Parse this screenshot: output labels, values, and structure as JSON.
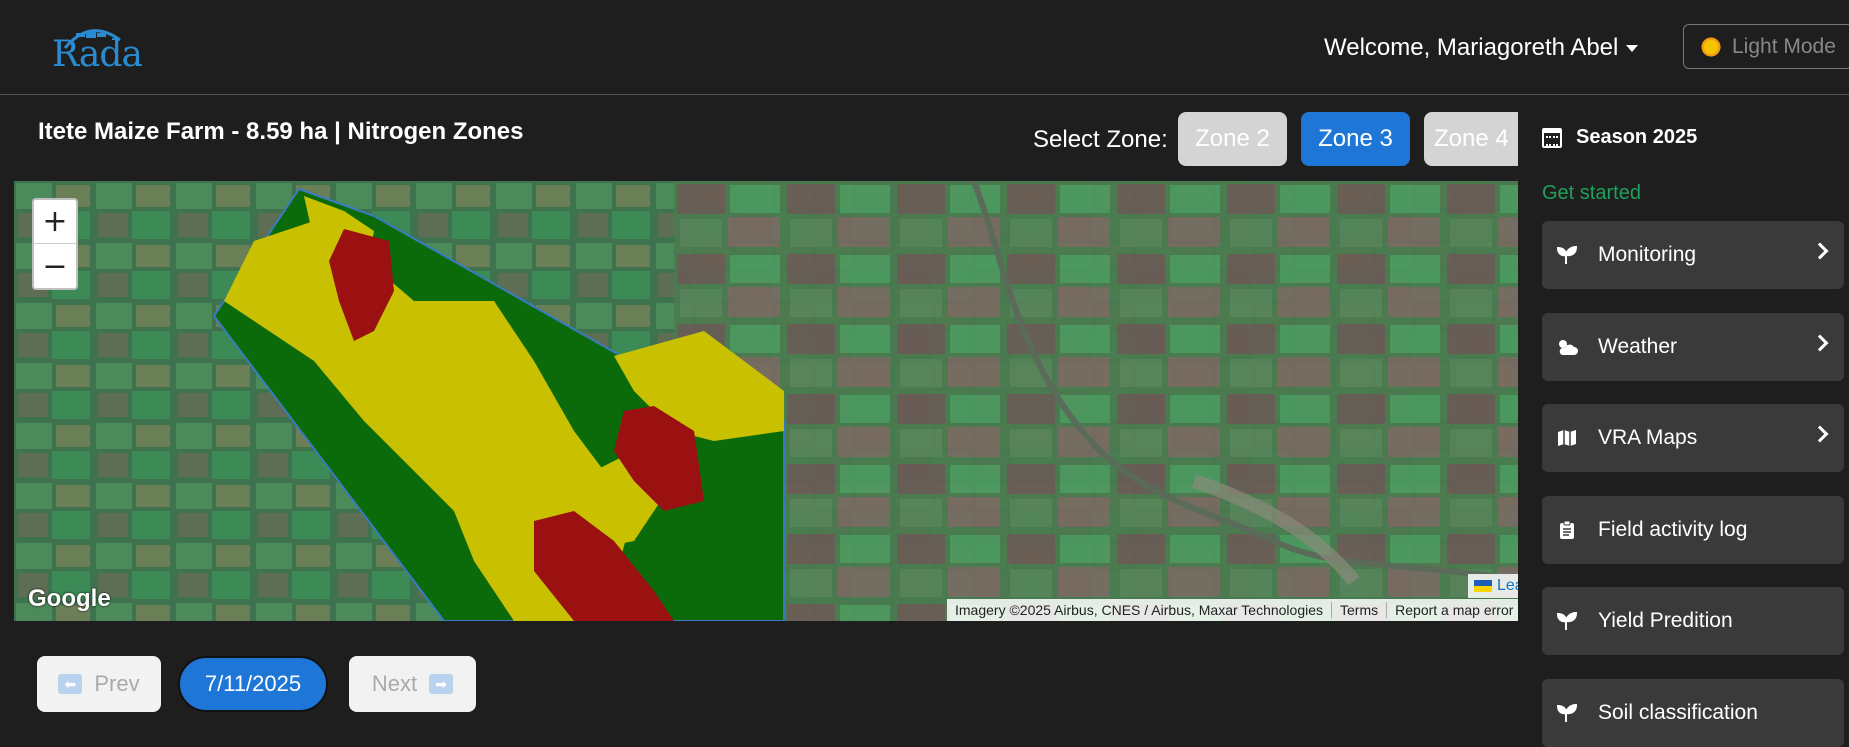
{
  "header": {
    "logo_text": "Rada",
    "welcome": "Welcome, Mariagoreth Abel",
    "mode_label": "Light Mode"
  },
  "main": {
    "title": "Itete Maize Farm - 8.59 ha | Nitrogen Zones",
    "select_zone_label": "Select Zone:",
    "zones": [
      {
        "label": "Zone 2",
        "active": false
      },
      {
        "label": "Zone 3",
        "active": true
      },
      {
        "label": "Zone 4",
        "active": false
      }
    ]
  },
  "map": {
    "zoom_in": "+",
    "zoom_out": "−",
    "google": "Google",
    "leaflet": "Leaflet",
    "attribution": {
      "imagery": "Imagery ©2025 Airbus, CNES / Airbus, Maxar Technologies",
      "terms": "Terms",
      "report": "Report a map error"
    },
    "zone_colors": {
      "high": "#9b1010",
      "medium": "#c8c000",
      "low": "#0b6b0b"
    }
  },
  "date_nav": {
    "prev": "Prev",
    "date": "7/11/2025",
    "next": "Next"
  },
  "sidebar": {
    "season": "Season 2025",
    "get_started": "Get started",
    "items": [
      {
        "label": "Monitoring",
        "icon": "seedling-icon",
        "chevron": true
      },
      {
        "label": "Weather",
        "icon": "cloud-sun-icon",
        "chevron": true
      },
      {
        "label": "VRA Maps",
        "icon": "map-icon",
        "chevron": true
      },
      {
        "label": "Field activity log",
        "icon": "clipboard-icon",
        "chevron": false
      },
      {
        "label": "Yield Predition",
        "icon": "seedling-icon",
        "chevron": false
      },
      {
        "label": "Soil classification",
        "icon": "seedling-icon",
        "chevron": false
      }
    ]
  }
}
